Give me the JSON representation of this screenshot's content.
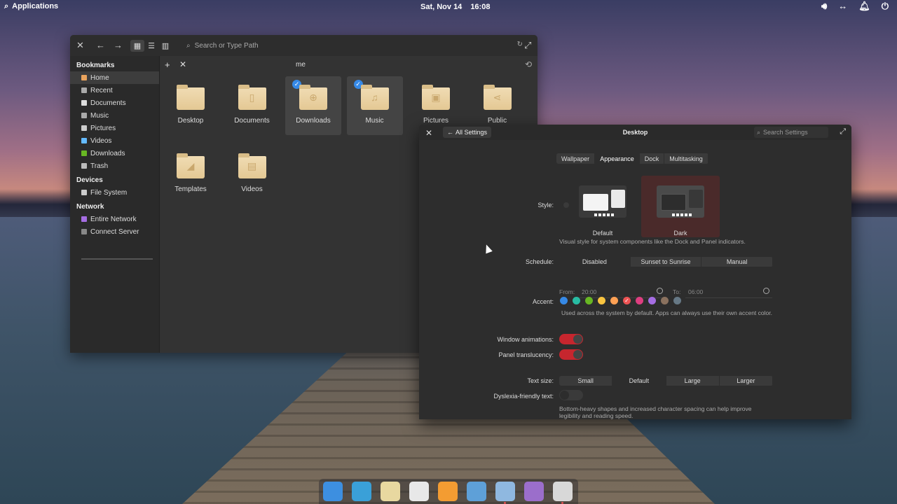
{
  "panel": {
    "apps_label": "Applications",
    "date": "Sat, Nov 14",
    "time": "16:08",
    "indicators": [
      "volume-icon",
      "network-icon",
      "notifications-icon",
      "power-icon"
    ]
  },
  "files": {
    "search_placeholder": "Search or Type Path",
    "tab_title": "me",
    "sidebar": {
      "bookmarks_header": "Bookmarks",
      "bookmarks": [
        {
          "label": "Home",
          "color": "#e9a35d"
        },
        {
          "label": "Recent",
          "color": "#aaaaaa"
        },
        {
          "label": "Documents",
          "color": "#dddddd"
        },
        {
          "label": "Music",
          "color": "#aaaaaa"
        },
        {
          "label": "Pictures",
          "color": "#cccccc"
        },
        {
          "label": "Videos",
          "color": "#64baff"
        },
        {
          "label": "Downloads",
          "color": "#68b723"
        },
        {
          "label": "Trash",
          "color": "#bbbbbb"
        }
      ],
      "devices_header": "Devices",
      "devices": [
        {
          "label": "File System",
          "color": "#cccccc"
        }
      ],
      "network_header": "Network",
      "network": [
        {
          "label": "Entire Network",
          "color": "#a56de2"
        },
        {
          "label": "Connect Server",
          "color": "#888888"
        }
      ]
    },
    "items": [
      {
        "name": "Desktop",
        "glyph": "",
        "selected": false
      },
      {
        "name": "Documents",
        "glyph": "▯",
        "selected": false
      },
      {
        "name": "Downloads",
        "glyph": "⊕",
        "selected": true
      },
      {
        "name": "Music",
        "glyph": "♫",
        "selected": true
      },
      {
        "name": "Pictures",
        "glyph": "▣",
        "selected": false
      },
      {
        "name": "Public",
        "glyph": "⋖",
        "selected": false
      },
      {
        "name": "Templates",
        "glyph": "◢",
        "selected": false
      },
      {
        "name": "Videos",
        "glyph": "▤",
        "selected": false
      }
    ]
  },
  "settings": {
    "back_label": "All Settings",
    "title": "Desktop",
    "search_placeholder": "Search Settings",
    "tabs": [
      "Wallpaper",
      "Appearance",
      "Dock",
      "Multitasking"
    ],
    "active_tab": "Appearance",
    "style": {
      "label": "Style:",
      "default_caption": "Default",
      "dark_caption": "Dark",
      "selected": "Dark",
      "description": "Visual style for system components like the Dock and Panel indicators."
    },
    "schedule": {
      "label": "Schedule:",
      "options": [
        "Disabled",
        "Sunset to Sunrise",
        "Manual"
      ],
      "selected": "Disabled",
      "from_label": "From:",
      "from_value": "20:00",
      "to_label": "To:",
      "to_value": "06:00"
    },
    "accent": {
      "label": "Accent:",
      "colors": [
        "#3689e6",
        "#28bca3",
        "#68b723",
        "#f9c440",
        "#ffa154",
        "#ed5353",
        "#de3e80",
        "#a56de2",
        "#8a715e",
        "#667885"
      ],
      "selected_index": 5,
      "description": "Used across the system by default. Apps can always use their own accent color."
    },
    "window_animations_label": "Window animations:",
    "window_animations": true,
    "panel_translucency_label": "Panel translucency:",
    "panel_translucency": true,
    "text_size": {
      "label": "Text size:",
      "options": [
        "Small",
        "Default",
        "Large",
        "Larger"
      ],
      "selected": "Default"
    },
    "dyslexia_label": "Dyslexia-friendly text:",
    "dyslexia": false,
    "dyslexia_desc_1": "Bottom-heavy shapes and increased character spacing can help improve",
    "dyslexia_desc_2": "legibility and reading speed."
  },
  "dock": {
    "apps": [
      {
        "name": "multitasking-view-icon",
        "color": "#3d8fe0",
        "running": false
      },
      {
        "name": "web-browser-icon",
        "color": "#3aa0d8",
        "running": false
      },
      {
        "name": "mail-icon",
        "color": "#e8d8a0",
        "running": false
      },
      {
        "name": "calendar-icon",
        "color": "#e8e8e8",
        "running": false
      },
      {
        "name": "music-icon",
        "color": "#f39c32",
        "running": false
      },
      {
        "name": "photos-icon",
        "color": "#5ea0d8",
        "running": false
      },
      {
        "name": "system-settings-icon",
        "color": "#8fb8e0",
        "running": true
      },
      {
        "name": "appcenter-icon",
        "color": "#9b6ecb",
        "running": false
      },
      {
        "name": "files-icon",
        "color": "#d8d8d8",
        "running": true
      }
    ]
  }
}
